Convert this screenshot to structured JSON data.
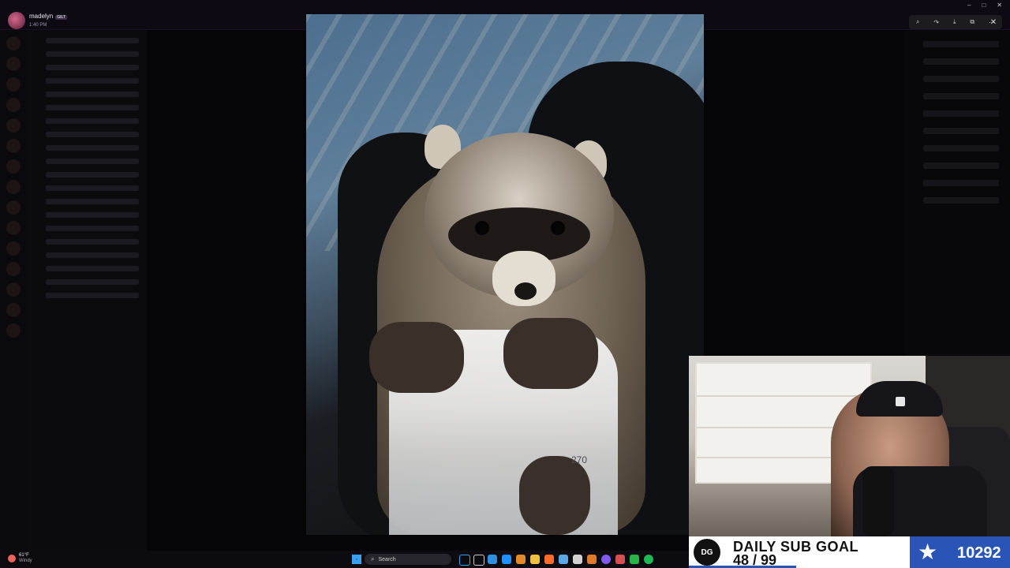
{
  "user": {
    "name": "madelyn",
    "tag": "GILT",
    "time": "1:40 PM"
  },
  "window_controls": [
    "–",
    "□",
    "✕"
  ],
  "viewer_toolbar": {
    "icons": [
      "zoom-icon",
      "share-icon",
      "download-icon",
      "open-external-icon",
      "more-icon"
    ],
    "glyphs": [
      "⌕",
      "↷",
      "⤓",
      "⧉",
      "⋯"
    ],
    "close": "✕"
  },
  "photo": {
    "bottle_mark": "270"
  },
  "subgoal": {
    "title": "DAILY SUB GOAL",
    "count": "48 / 99",
    "progress": 0.4848,
    "total": "10292",
    "star": "★",
    "logo": "DG"
  },
  "taskbar": {
    "weather_temp": "61°F",
    "weather_desc": "Windy",
    "search_placeholder": "Search",
    "search_icon": "⌕",
    "icon_colors": [
      "#3aa0f0",
      "#c9c9d0",
      "#2f8fe0",
      "#1e90ff",
      "#e08a2b",
      "#f0c040",
      "#ff6a2b",
      "#5aa7e6",
      "#d1d1d1",
      "#e07a2b",
      "#7f5af0",
      "#d94f4f",
      "#2bb34a",
      "#1db954"
    ]
  }
}
